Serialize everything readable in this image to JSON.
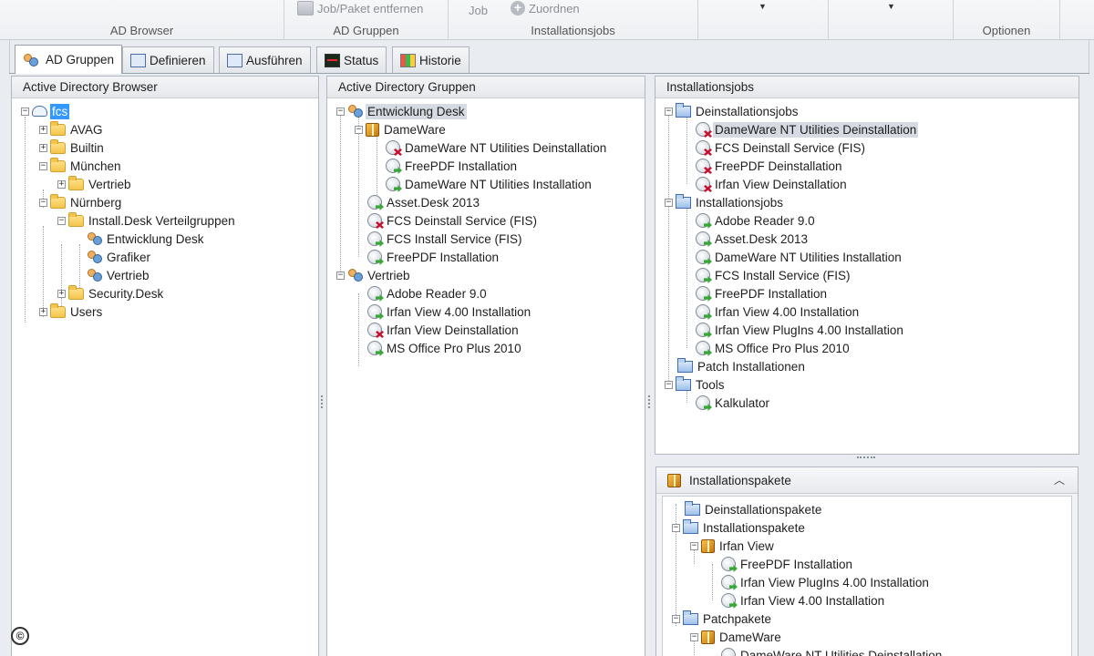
{
  "ribbon": {
    "groups": [
      {
        "caption": "AD Browser"
      },
      {
        "caption": "AD Gruppen",
        "button": "Job/Paket entfernen"
      },
      {
        "caption": "Installationsjobs",
        "button_job": "Job",
        "button_assign": "Zuordnen"
      },
      {
        "caption": ""
      },
      {
        "caption": ""
      },
      {
        "caption": "Optionen"
      }
    ]
  },
  "tabs": [
    {
      "label": "AD Gruppen",
      "active": true
    },
    {
      "label": "Definieren"
    },
    {
      "label": "Ausführen"
    },
    {
      "label": "Status"
    },
    {
      "label": "Historie"
    }
  ],
  "panels": {
    "ad_browser": {
      "title": "Active Directory Browser",
      "nodes": [
        "fcs",
        "AVAG",
        "Builtin",
        "München",
        "Vertrieb",
        "Nürnberg",
        "Install.Desk Verteilgruppen",
        "Entwicklung Desk",
        "Grafiker",
        "Vertrieb",
        "Security.Desk",
        "Users"
      ]
    },
    "ad_groups": {
      "title": "Active Directory Gruppen",
      "nodes": [
        "Entwicklung Desk",
        "DameWare",
        "DameWare NT Utilities Deinstallation",
        "FreePDF Installation",
        "DameWare NT Utilities Installation",
        "Asset.Desk 2013",
        "FCS Deinstall Service (FIS)",
        "FCS Install Service (FIS)",
        "FreePDF Installation",
        "Vertrieb",
        "Adobe Reader 9.0",
        "Irfan View 4.00 Installation",
        "Irfan View Deinstallation",
        "MS Office Pro Plus 2010"
      ]
    },
    "jobs": {
      "title": "Installationsjobs",
      "nodes": [
        "Deinstallationsjobs",
        "DameWare NT Utilities Deinstallation",
        "FCS Deinstall Service (FIS)",
        "FreePDF Deinstallation",
        "Irfan View Deinstallation",
        "Installationsjobs",
        "Adobe Reader 9.0",
        "Asset.Desk 2013",
        "DameWare NT Utilities Installation",
        "FCS Install Service (FIS)",
        "FreePDF Installation",
        "Irfan View 4.00 Installation",
        "Irfan View PlugIns 4.00 Installation",
        "MS Office Pro Plus 2010",
        "Patch Installationen",
        "Tools",
        "Kalkulator"
      ]
    },
    "packages": {
      "title": "Installationspakete",
      "nodes": [
        "Deinstallationspakete",
        "Installationspakete",
        "Irfan View",
        "FreePDF Installation",
        "Irfan View PlugIns 4.00 Installation",
        "Irfan View 4.00 Installation",
        "Patchpakete",
        "DameWare",
        "DameWare NT Utilities Deinstallation"
      ]
    }
  },
  "status": {
    "copyright_symbol": "©"
  }
}
